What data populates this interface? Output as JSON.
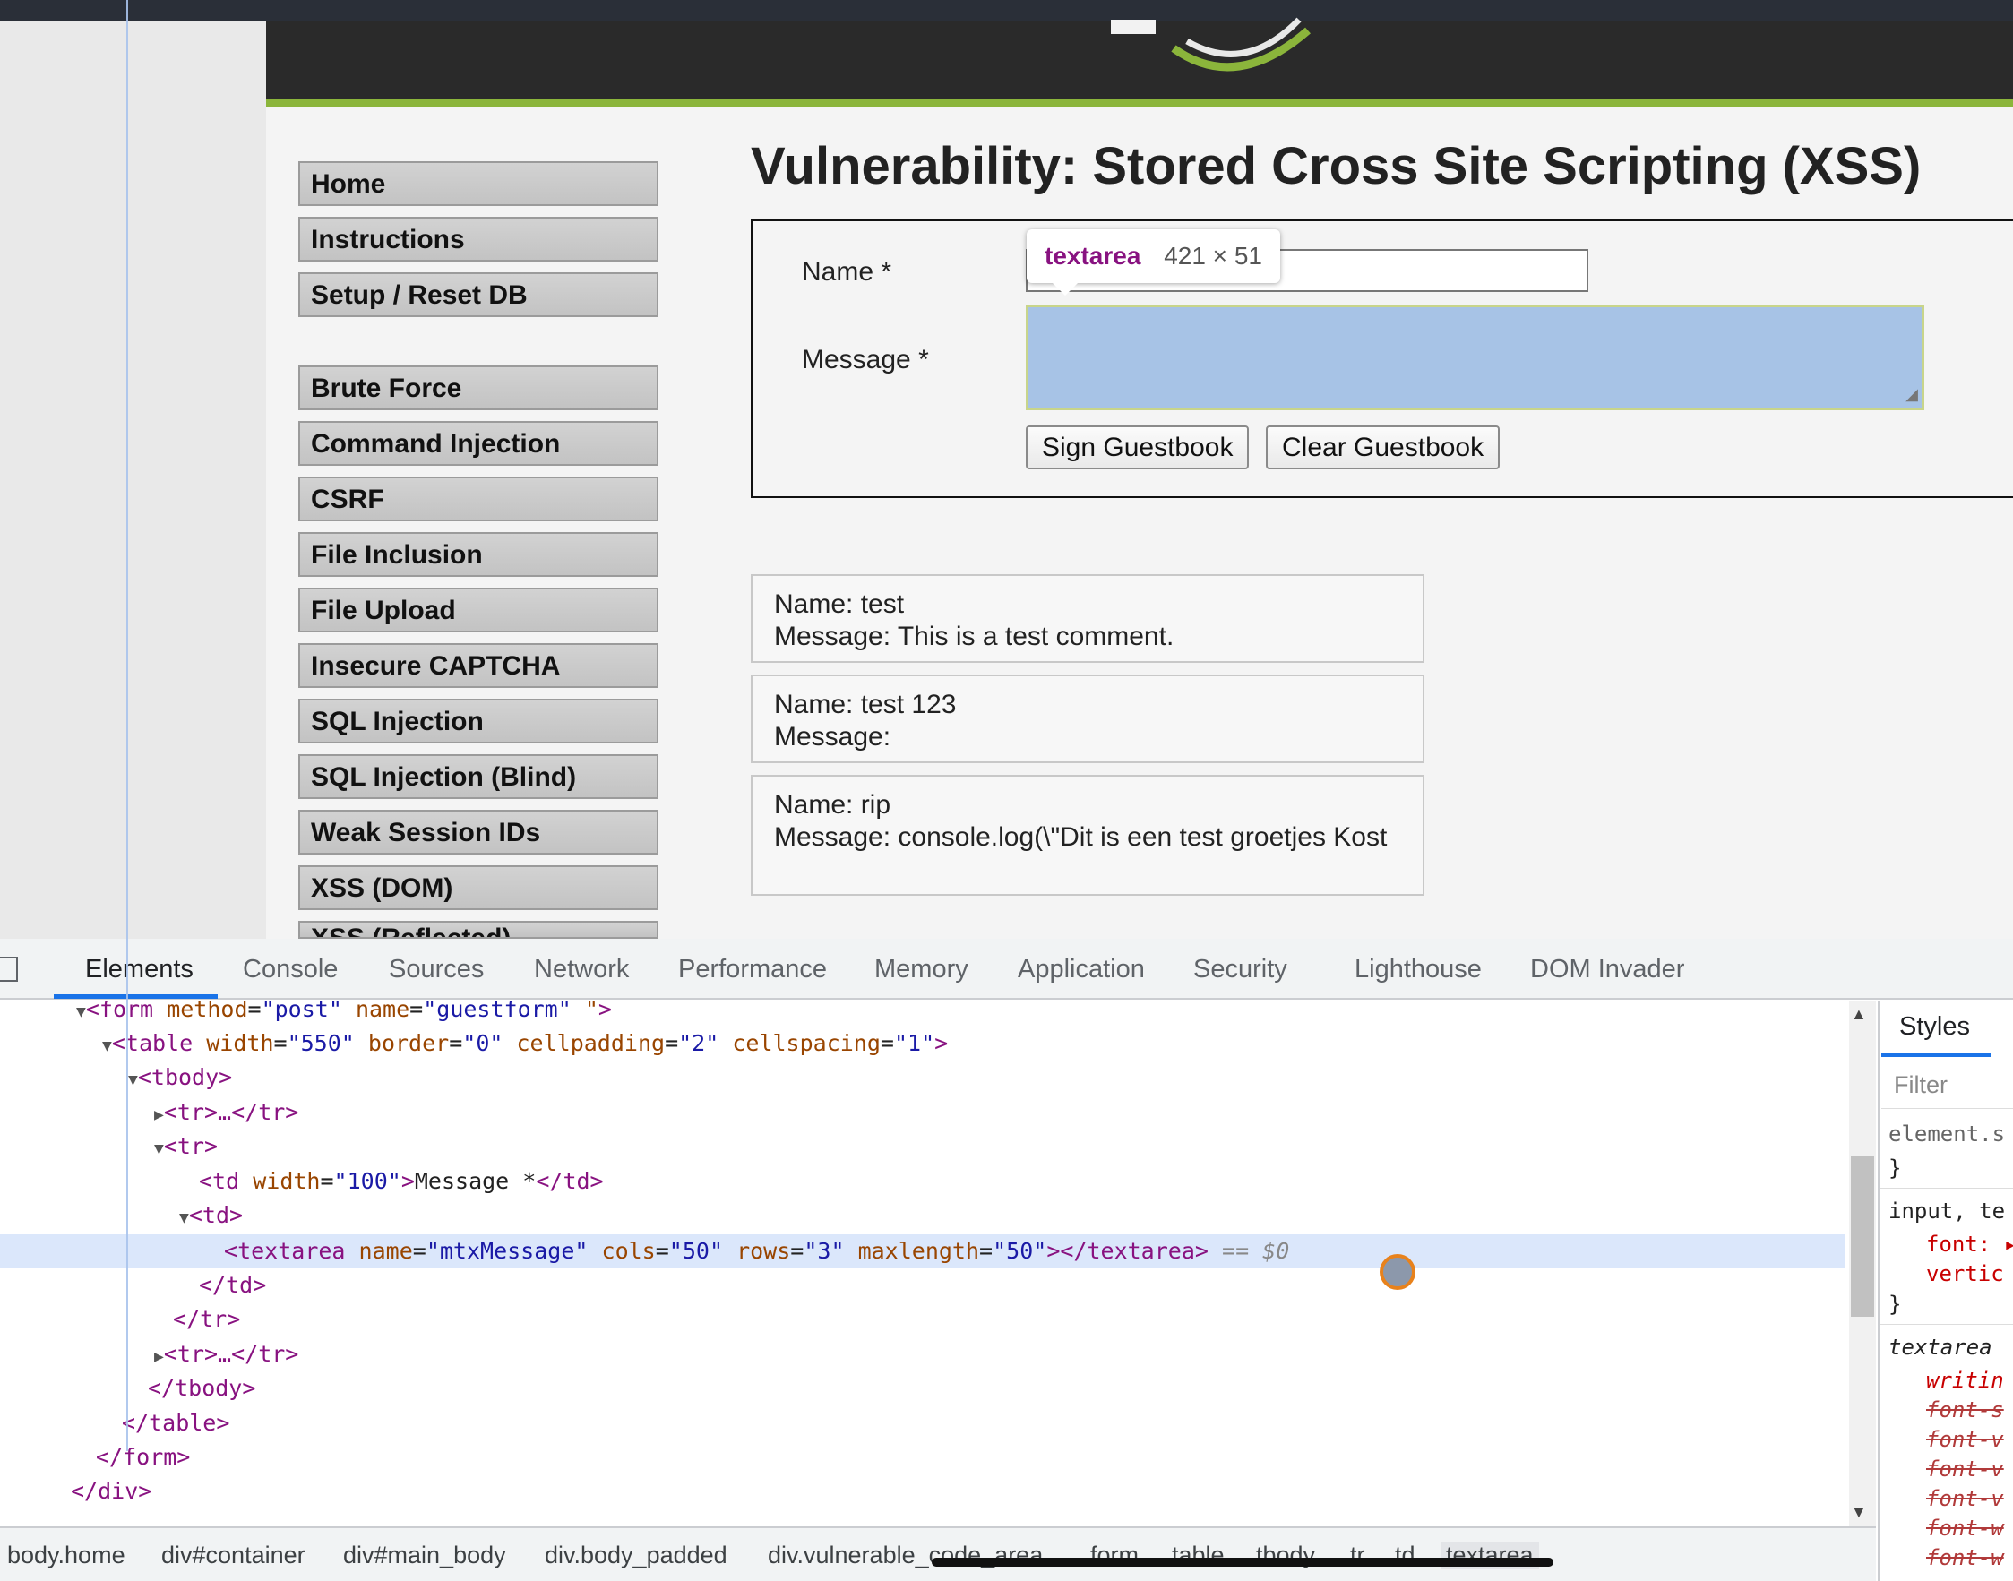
{
  "menu": [
    "Home",
    "Instructions",
    "Setup / Reset DB",
    "Brute Force",
    "Command Injection",
    "CSRF",
    "File Inclusion",
    "File Upload",
    "Insecure CAPTCHA",
    "SQL Injection",
    "SQL Injection (Blind)",
    "Weak Session IDs",
    "XSS (DOM)",
    "XSS (Reflected)"
  ],
  "page_title": "Vulnerability: Stored Cross Site Scripting (XSS)",
  "form": {
    "name_label": "Name *",
    "message_label": "Message *",
    "sign_button": "Sign Guestbook",
    "clear_button": "Clear Guestbook"
  },
  "tooltip": {
    "tag": "textarea",
    "size": "421 × 51"
  },
  "entries": [
    {
      "name": "Name: test",
      "message": "Message: This is a test comment."
    },
    {
      "name": "Name: test 123",
      "message": "Message:"
    },
    {
      "name": "Name: rip",
      "message": "Message: console.log(\\\"Dit is een test groetjes Kost"
    }
  ],
  "devtools": {
    "tabs": [
      "Elements",
      "Console",
      "Sources",
      "Network",
      "Performance",
      "Memory",
      "Application",
      "Security",
      "Lighthouse",
      "DOM Invader"
    ],
    "code": {
      "l1_tag": "form",
      "l1_a1": "method",
      "l1_v1": "\"post\"",
      "l1_a2": "name",
      "l1_v2": "\"guestform\"",
      "l1_a3": "\"",
      "l2_tag": "table",
      "l2_a1": "width",
      "l2_v1": "\"550\"",
      "l2_a2": "border",
      "l2_v2": "\"0\"",
      "l2_a3": "cellpadding",
      "l2_v3": "\"2\"",
      "l2_a4": "cellspacing",
      "l2_v4": "\"1\"",
      "l3": "<tbody>",
      "l4": "<tr>…</tr>",
      "l5": "<tr>",
      "l6_open": "<td ",
      "l6_attr": "width",
      "l6_val": "\"100\"",
      "l6_text": "Message *",
      "l6_close": "</td>",
      "l7": "<td>",
      "l8_tag": "textarea",
      "l8_a1": "name",
      "l8_v1": "\"mtxMessage\"",
      "l8_a2": "cols",
      "l8_v2": "\"50\"",
      "l8_a3": "rows",
      "l8_v3": "\"3\"",
      "l8_a4": "maxlength",
      "l8_v4": "\"50\"",
      "l8_close": "></textarea>",
      "l8_marker": "== $0",
      "l9": "</td>",
      "l10": "</tr>",
      "l11": "<tr>…</tr>",
      "l12": "</tbody>",
      "l13": "</table>",
      "l14": "</form>",
      "l15": "</div>"
    },
    "styles": {
      "tab": "Styles",
      "filter_placeholder": "Filter",
      "lines": [
        "element.s",
        "}",
        "input, te",
        "font: ▸",
        "vertic",
        "}",
        "textarea",
        "writin",
        "font-s",
        "font-v",
        "font-v",
        "font-v",
        "font-w",
        "font-w"
      ]
    },
    "breadcrumb": [
      "body.home",
      "div#container",
      "div#main_body",
      "div.body_padded",
      "div.vulnerable_code_area",
      "form",
      "table",
      "tbody",
      "tr",
      "td",
      "textarea"
    ]
  },
  "colors": {
    "accent": "#1a73e8",
    "header_green": "#8bb53b",
    "selection": "#dbe7fb"
  }
}
